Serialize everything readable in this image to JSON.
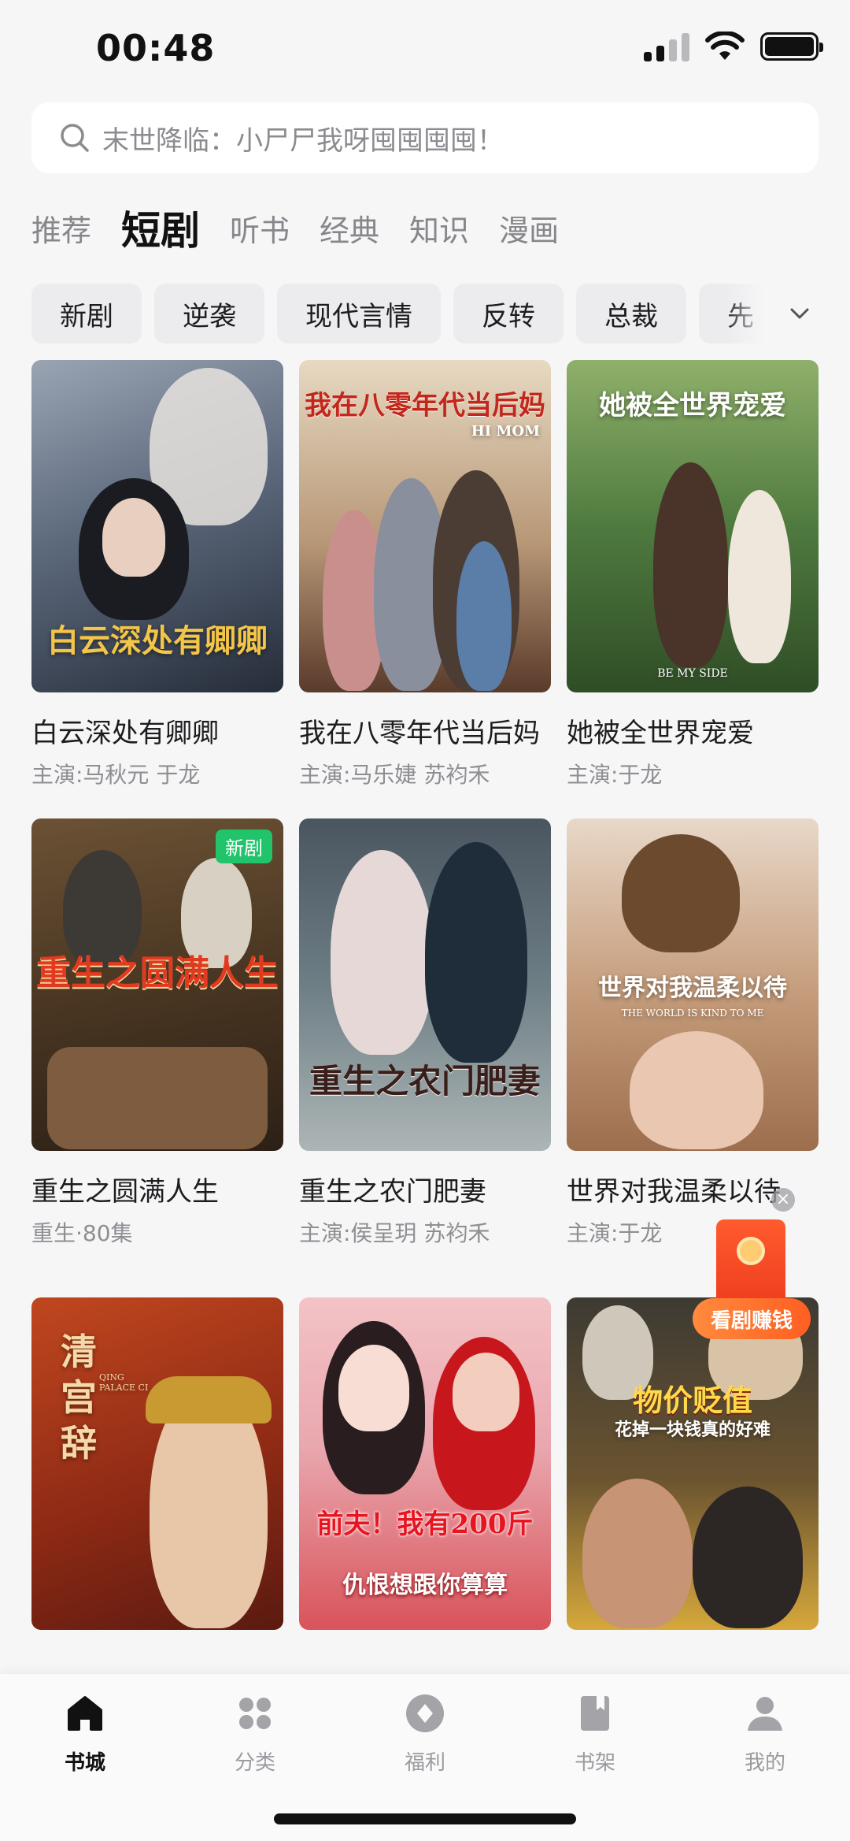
{
  "status_bar": {
    "time": "00:48"
  },
  "search": {
    "placeholder": "末世降临：小尸尸我呀囤囤囤囤！"
  },
  "tabs": [
    {
      "label": "推荐",
      "active": false
    },
    {
      "label": "短剧",
      "active": true
    },
    {
      "label": "听书",
      "active": false
    },
    {
      "label": "经典",
      "active": false
    },
    {
      "label": "知识",
      "active": false
    },
    {
      "label": "漫画",
      "active": false
    }
  ],
  "chips": [
    "新剧",
    "逆袭",
    "现代言情",
    "反转",
    "总裁",
    "先"
  ],
  "cards": [
    {
      "title": "白云深处有卿卿",
      "sub": "主演:马秋元 于龙",
      "poster_text": "白云深处有卿卿",
      "badge": ""
    },
    {
      "title": "我在八零年代当后妈",
      "sub": "主演:马乐婕 苏袀禾",
      "poster_text": "我在八零年代当后妈",
      "poster_text_2": "HI MOM",
      "badge": ""
    },
    {
      "title": "她被全世界宠爱",
      "sub": "主演:于龙",
      "poster_text": "她被全世界宠爱",
      "poster_text_2": "BE MY SIDE",
      "badge": ""
    },
    {
      "title": "重生之圆满人生",
      "sub": "重生·80集",
      "poster_text": "重生之圆满人生",
      "badge": "新剧"
    },
    {
      "title": "重生之农门肥妻",
      "sub": "主演:侯呈玥 苏袀禾",
      "poster_text": "重生之农门肥妻",
      "badge": ""
    },
    {
      "title": "世界对我温柔以待",
      "sub": "主演:于龙",
      "poster_text": "世界对我温柔以待",
      "poster_text_2": "THE WORLD IS KIND TO ME",
      "badge": ""
    },
    {
      "title": "",
      "sub": "",
      "poster_text": "清宫辞",
      "poster_text_2": "QING PALACE CI",
      "badge": ""
    },
    {
      "title": "",
      "sub": "",
      "poster_text": "前夫！我有200斤",
      "poster_text_2": "仇恨想跟你算算",
      "badge": ""
    },
    {
      "title": "",
      "sub": "",
      "poster_text": "物价贬值",
      "poster_text_2": "花掉一块钱真的好难",
      "badge": ""
    }
  ],
  "float_reward": {
    "label": "看剧赚钱"
  },
  "bottom_nav": [
    {
      "label": "书城",
      "icon": "home-icon",
      "active": true
    },
    {
      "label": "分类",
      "icon": "category-icon",
      "active": false
    },
    {
      "label": "福利",
      "icon": "welfare-icon",
      "active": false
    },
    {
      "label": "书架",
      "icon": "bookshelf-icon",
      "active": false
    },
    {
      "label": "我的",
      "icon": "profile-icon",
      "active": false
    }
  ]
}
